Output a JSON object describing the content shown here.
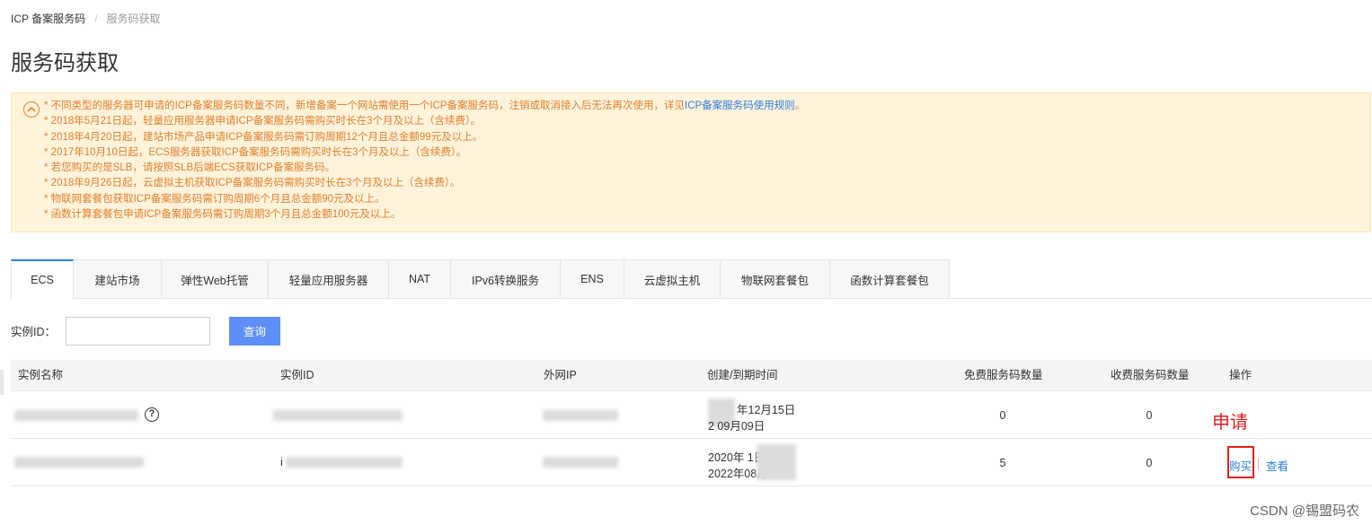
{
  "breadcrumb": {
    "root": "ICP 备案服务码",
    "separator": "/",
    "current": "服务码获取"
  },
  "page_title": "服务码获取",
  "notice": {
    "first_line": "* 不同类型的服务器可申请的ICP备案服务码数量不同，新增备案一个网站需使用一个ICP备案服务码，注销或取消接入后无法再次使用，详见",
    "first_line_link": "ICP备案服务码使用规则",
    "first_line_end": "。",
    "lines": [
      "* 2018年5月21日起，轻量应用服务器申请ICP备案服务码需购买时长在3个月及以上（含续费）。",
      "* 2018年4月20日起，建站市场产品申请ICP备案服务码需订购周期12个月且总金额99元及以上。",
      "* 2017年10月10日起，ECS服务器获取ICP备案服务码需购买时长在3个月及以上（含续费）。",
      "* 若您购买的是SLB，请按照SLB后端ECS获取ICP备案服务码。",
      "* 2018年9月26日起，云虚拟主机获取ICP备案服务码需购买时长在3个月及以上（含续费）。",
      "* 物联网套餐包获取ICP备案服务码需订购周期6个月且总金额90元及以上。",
      "* 函数计算套餐包申请ICP备案服务码需订购周期3个月且总金额100元及以上。"
    ]
  },
  "tabs": [
    {
      "label": "ECS",
      "active": true
    },
    {
      "label": "建站市场"
    },
    {
      "label": "弹性Web托管"
    },
    {
      "label": "轻量应用服务器"
    },
    {
      "label": "NAT"
    },
    {
      "label": "IPv6转换服务"
    },
    {
      "label": "ENS"
    },
    {
      "label": "云虚拟主机"
    },
    {
      "label": "物联网套餐包"
    },
    {
      "label": "函数计算套餐包"
    }
  ],
  "search": {
    "label": "实例ID：",
    "value": "",
    "placeholder": "",
    "button": "查询"
  },
  "table": {
    "headers": {
      "name": "实例名称",
      "id": "实例ID",
      "ip": "外网IP",
      "time": "创建/到期时间",
      "free_count": "免费服务码数量",
      "paid_count": "收费服务码数量",
      "actions": "操作"
    },
    "rows": [
      {
        "help": "?",
        "created": "年12月15日",
        "expires": "2   09月09日",
        "free_count": "0",
        "paid_count": "0"
      },
      {
        "id_prefix": "i",
        "created": "2020年  1日",
        "expires": "2022年08月",
        "free_count": "5",
        "paid_count": "0",
        "buy_label": "购买",
        "view_label": "查看"
      }
    ]
  },
  "annotation": {
    "text": "申请",
    "color": "#e0201a"
  },
  "watermark": "CSDN @锡盟码农",
  "colors": {
    "accent": "#2f7fe0",
    "button": "#5e8ff7",
    "notice_text": "#e0802c",
    "notice_bg": "#fff3dc"
  }
}
